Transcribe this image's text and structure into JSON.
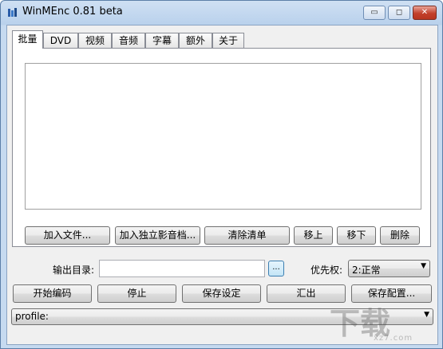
{
  "window": {
    "title": "WinMEnc 0.81 beta",
    "controls": {
      "minimize": "▭",
      "maximize": "◻",
      "close": "✕"
    }
  },
  "tabs": [
    {
      "label": "批量",
      "active": true
    },
    {
      "label": "DVD"
    },
    {
      "label": "视频"
    },
    {
      "label": "音频"
    },
    {
      "label": "字幕"
    },
    {
      "label": "额外"
    },
    {
      "label": "关于"
    }
  ],
  "file_list": {
    "items": []
  },
  "list_buttons": {
    "add_file": "加入文件...",
    "add_separate_audio": "加入独立影音档...",
    "clear_list": "清除清单",
    "move_up": "移上",
    "move_down": "移下",
    "delete": "删除"
  },
  "output": {
    "dir_label": "输出目录:",
    "dir_value": "",
    "browse_label": "..."
  },
  "priority": {
    "label": "优先权:",
    "selected": "2:正常"
  },
  "action_buttons": {
    "start_encoding": "开始编码",
    "stop": "停止",
    "save_settings": "保存设定",
    "export": "汇出",
    "save_config": "保存配置..."
  },
  "profile": {
    "selected": "profile:"
  },
  "watermark": {
    "text": "下载",
    "sub": "xz7.com"
  },
  "colors": {
    "frame": "#c6daf0",
    "client": "#f0f0f0",
    "close_button": "#c2402b"
  }
}
